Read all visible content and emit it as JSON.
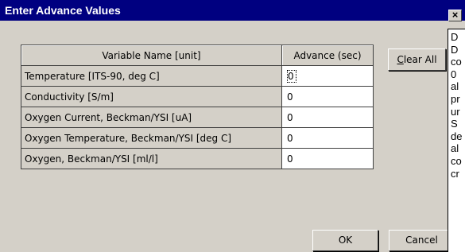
{
  "window": {
    "title": "Enter Advance Values",
    "close_glyph": "×"
  },
  "table": {
    "headers": [
      "Variable Name [unit]",
      "Advance (sec)"
    ],
    "rows": [
      {
        "name": "Temperature [ITS-90, deg C]",
        "value": "0"
      },
      {
        "name": "Conductivity [S/m]",
        "value": "0"
      },
      {
        "name": "Oxygen Current, Beckman/YSI [uA]",
        "value": "0"
      },
      {
        "name": "Oxygen Temperature, Beckman/YSI [deg C]",
        "value": "0"
      },
      {
        "name": "Oxygen, Beckman/YSI [ml/l]",
        "value": "0"
      }
    ]
  },
  "buttons": {
    "clear_all_first": "C",
    "clear_all_rest": "lear All",
    "ok": "OK",
    "cancel": "Cancel"
  },
  "help_panel": {
    "lines": [
      "D",
      "D",
      "co",
      "0",
      "al",
      "pr",
      "ur",
      "S",
      "de",
      "al",
      "co",
      "cr"
    ]
  }
}
